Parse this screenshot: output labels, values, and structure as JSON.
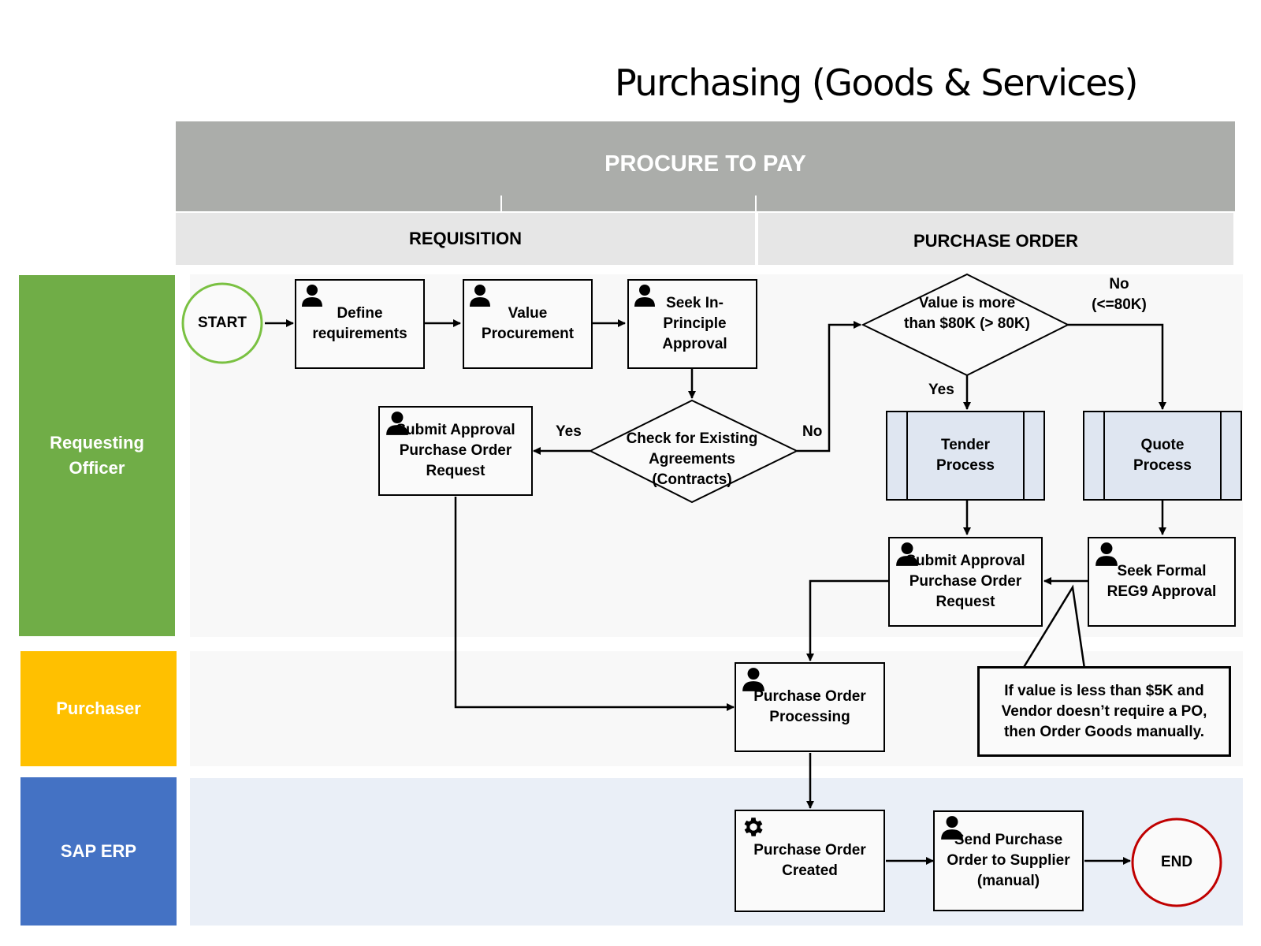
{
  "title": "Purchasing (Goods & Services)",
  "phases": {
    "main": "PROCURE TO PAY",
    "sub": [
      "REQUISITION",
      "PURCHASE ORDER"
    ]
  },
  "lanes": [
    {
      "label": "Requesting Officer",
      "color": "#70ad47"
    },
    {
      "label": "Purchaser",
      "color": "#ffc000"
    },
    {
      "label": "SAP ERP",
      "color": "#4472c4"
    }
  ],
  "nodes": {
    "start": "START",
    "define": "Define requirements",
    "value": "Value Procurement",
    "seek_in_principle": "Seek In-Principle Approval",
    "check_agreements": "Check for Existing Agreements (Contracts)",
    "submit_left": "Submit Approval Purchase Order Request",
    "value_decision": "Value is more than $80K (> 80K)",
    "tender": "Tender Process",
    "quote": "Quote Process",
    "submit_right": "Submit Approval Purchase Order Request",
    "seek_formal": "Seek Formal REG9 Approval",
    "po_processing": "Purchase Order Processing",
    "po_created": "Purchase Order Created",
    "send_po": "Send Purchase Order to Supplier (manual)",
    "end": "END"
  },
  "edge_labels": {
    "yes_left": "Yes",
    "no_check": "No",
    "yes_value": "Yes",
    "no_value": "No (<=80K)"
  },
  "note": "If value is less than $5K and Vendor doesn’t require a PO, then Order Goods manually.",
  "icons": {
    "person": "person-icon",
    "gear": "gear-icon"
  },
  "colors": {
    "start_border": "#7ac142",
    "end_border": "#c00000",
    "subprocess_fill": "#dfe6f1",
    "phase_main": "#abadaa",
    "phase_sub": "#e6e6e6"
  }
}
